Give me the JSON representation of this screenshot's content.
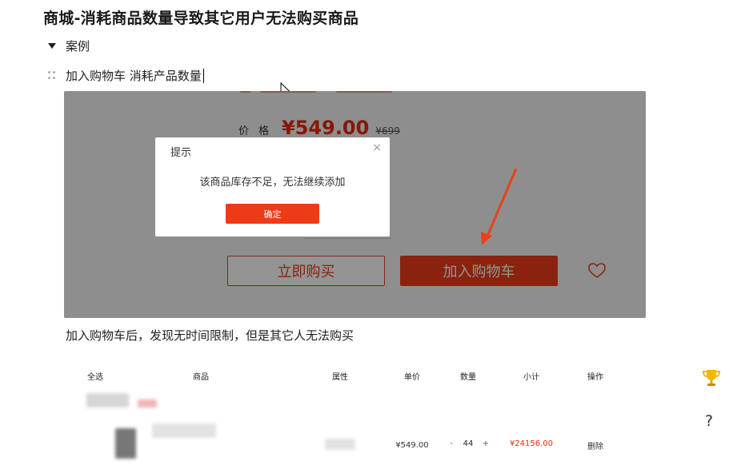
{
  "doc": {
    "title": "商城-消耗商品数量导致其它用户无法购买商品",
    "toggle_label": "案例",
    "line_text": "加入购物车  消耗产品数量",
    "caption": "加入购物车后，发现无时间限制，但是其它人无法购买"
  },
  "screenshot": {
    "price_label": "价格",
    "price": "¥549.00",
    "price_old": "¥699",
    "buy_now": "立即购买",
    "add_to_cart": "加入购物车",
    "dialog": {
      "title": "提示",
      "close": "×",
      "message": "该商品库存不足，无法继续添加",
      "confirm": "确定"
    },
    "colors": {
      "accent": "#ee3b17",
      "price": "#e8290c",
      "arrow": "#e8411c"
    }
  },
  "cart": {
    "columns": [
      "全选",
      "商品",
      "属性",
      "单价",
      "数量",
      "小计",
      "操作"
    ],
    "row": {
      "unit_price": "¥549.00",
      "minus": "-",
      "quantity": "44",
      "plus": "+",
      "subtotal": "¥24156.00",
      "action": "删除"
    },
    "colors": {
      "subtotal": "#e8290c"
    }
  },
  "icons": [
    "cursor-icon",
    "drag-handle-icon",
    "heart-icon",
    "close-icon",
    "trophy-icon",
    "help-icon"
  ],
  "help": "?"
}
